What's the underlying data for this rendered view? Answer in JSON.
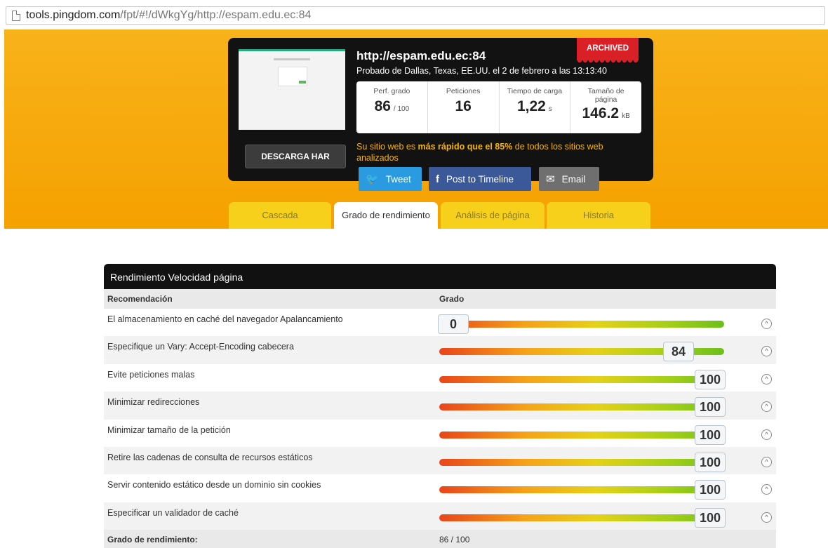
{
  "address_bar": {
    "host": "tools.pingdom.com",
    "path": "/fpt/#!/dWkgYg/http://espam.edu.ec:84"
  },
  "summary": {
    "site_url": "http://espam.edu.ec:84",
    "tested_from": "Probado de Dallas, Texas, EE.UU. el 2 de febrero a las 13:13:40",
    "archived_badge": "ARCHIVED",
    "stats": {
      "grade_label": "Perf. grado",
      "grade_value": "86",
      "grade_unit": "/ 100",
      "requests_label": "Peticiones",
      "requests_value": "16",
      "load_label": "Tiempo de carga",
      "load_value": "1,22",
      "load_unit": "s",
      "size_label": "Tamaño de página",
      "size_value": "146.2",
      "size_unit": "kB"
    },
    "faster_prefix": "Su sitio web es ",
    "faster_bold": "más rápido que el 85%",
    "faster_suffix": " de todos los sitios web analizados",
    "har_button": "DESCARGA HAR",
    "share": {
      "tweet": "Tweet",
      "facebook": "Post to Timeline",
      "email": "Email"
    }
  },
  "tabs": [
    {
      "label": "Cascada"
    },
    {
      "label": "Grado de rendimiento",
      "active": true
    },
    {
      "label": "Análisis de página"
    },
    {
      "label": "Historia"
    }
  ],
  "performance": {
    "title": "Rendimiento Velocidad página",
    "col_recommendation": "Recomendación",
    "col_grade": "Grado",
    "rows": [
      {
        "text": "El almacenamiento en caché del navegador Apalancamiento",
        "grade": 0
      },
      {
        "text": "Especifique un Vary: Accept-Encoding cabecera",
        "grade": 84
      },
      {
        "text": "Evite peticiones malas",
        "grade": 100
      },
      {
        "text": "Minimizar redirecciones",
        "grade": 100
      },
      {
        "text": "Minimizar tamaño de la petición",
        "grade": 100
      },
      {
        "text": "Retire las cadenas de consulta de recursos estáticos",
        "grade": 100
      },
      {
        "text": "Servir contenido estático desde un dominio sin cookies",
        "grade": 100
      },
      {
        "text": "Especificar un validador de caché",
        "grade": 100
      }
    ],
    "footer_label": "Grado de rendimiento:",
    "footer_value": "86 / 100"
  },
  "colors": {
    "orange": "#f5a100",
    "tab_yellow": "#f6d01a",
    "archived_red": "#d92026",
    "twitter": "#2a9be0",
    "facebook": "#3b5998"
  }
}
